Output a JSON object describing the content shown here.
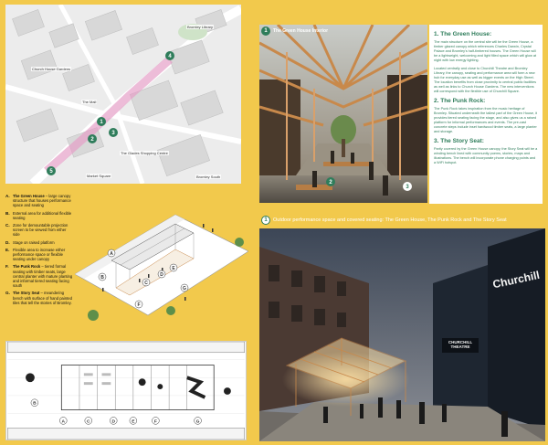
{
  "map": {
    "labels": {
      "library": "Bromley Library",
      "north_gardens": "Church House Gardens",
      "high_street": "The Mall",
      "shopping": "The Glades Shopping Centre",
      "market": "Market Square",
      "station": "Bromley South"
    },
    "markers": [
      "1",
      "2",
      "3",
      "4",
      "5"
    ]
  },
  "interior": {
    "badge": "1",
    "title": "The Green House Interior",
    "markers": [
      "2",
      "3"
    ]
  },
  "text_panel": {
    "sections": [
      {
        "heading": "1. The Green House:",
        "paragraphs": [
          "The main structure on the central site will be the Green House, a timber glazed canopy which references Charles Darwin, Crystal Palace and Bromley's half-timbered houses. The Green House will be a lightweight, welcoming and light filled space which will glow at night with low energy lighting.",
          "Located centrally and close to Churchill Theatre and Bromley Library, the canopy, seating and performance area will form a new hub for everyday use as well as bigger events on the High Street. The location benefits from close proximity to central public facilities as well as links to Church House Gardens. The new interventions will correspond with the flexible use of Churchill Square."
        ]
      },
      {
        "heading": "2. The Punk Rock:",
        "paragraphs": [
          "The Punk Rock takes inspiration from the music heritage of Bromley. Situated underneath the tallest part of the Green House, it provides tiered seating facing the stage, and also gives us a raised platform for informal performances and events. The pre-cast concrete steps include inset hardwood timber seats, a large planter and storage."
        ]
      },
      {
        "heading": "3. The Story Seat:",
        "paragraphs": [
          "Partly covered by the Green House canopy, the Story Seat will be a winding bench lined with community poems, stories, maps and illustrations. The bench will incorporate phone charging points and a WiFi hotspot."
        ]
      }
    ]
  },
  "legend": {
    "items": [
      {
        "key": "A.",
        "name": "The Green House",
        "text": " – large canopy structure that houses performance space and seating"
      },
      {
        "key": "B.",
        "name": "",
        "text": "External area for additional flexible seating"
      },
      {
        "key": "C.",
        "name": "",
        "text": "Zone for demountable projection screen to be viewed from either side"
      },
      {
        "key": "D.",
        "name": "",
        "text": "Stage on raised platform"
      },
      {
        "key": "E.",
        "name": "",
        "text": "Flexible area to increase either performance space or flexible seating under canopy"
      },
      {
        "key": "F.",
        "name": "The Punk Rock",
        "text": " – tiered formal seating with timber seats, large central planter with mature planting and informal tiered seating facing south"
      },
      {
        "key": "G.",
        "name": "The Story Seat",
        "text": " – meandering bench with surface of hand painted tiles that tell the stories of Bromley."
      }
    ]
  },
  "axo": {
    "markers": [
      "A",
      "B",
      "C",
      "D",
      "E",
      "F",
      "G"
    ]
  },
  "plan": {
    "markers": [
      "A",
      "B",
      "C",
      "D",
      "E",
      "F",
      "G"
    ]
  },
  "street": {
    "badge": "1",
    "caption": "Outdoor performance space and covered seating: The Green House, The Punk Rock and The Story Seat",
    "sign_theatre": "CHURCHILL THEATRE",
    "sign_building": "Churchill"
  },
  "colors": {
    "background": "#f2c94c",
    "accent_green": "#2f7d5b",
    "route_pink": "#e6a0c8"
  }
}
